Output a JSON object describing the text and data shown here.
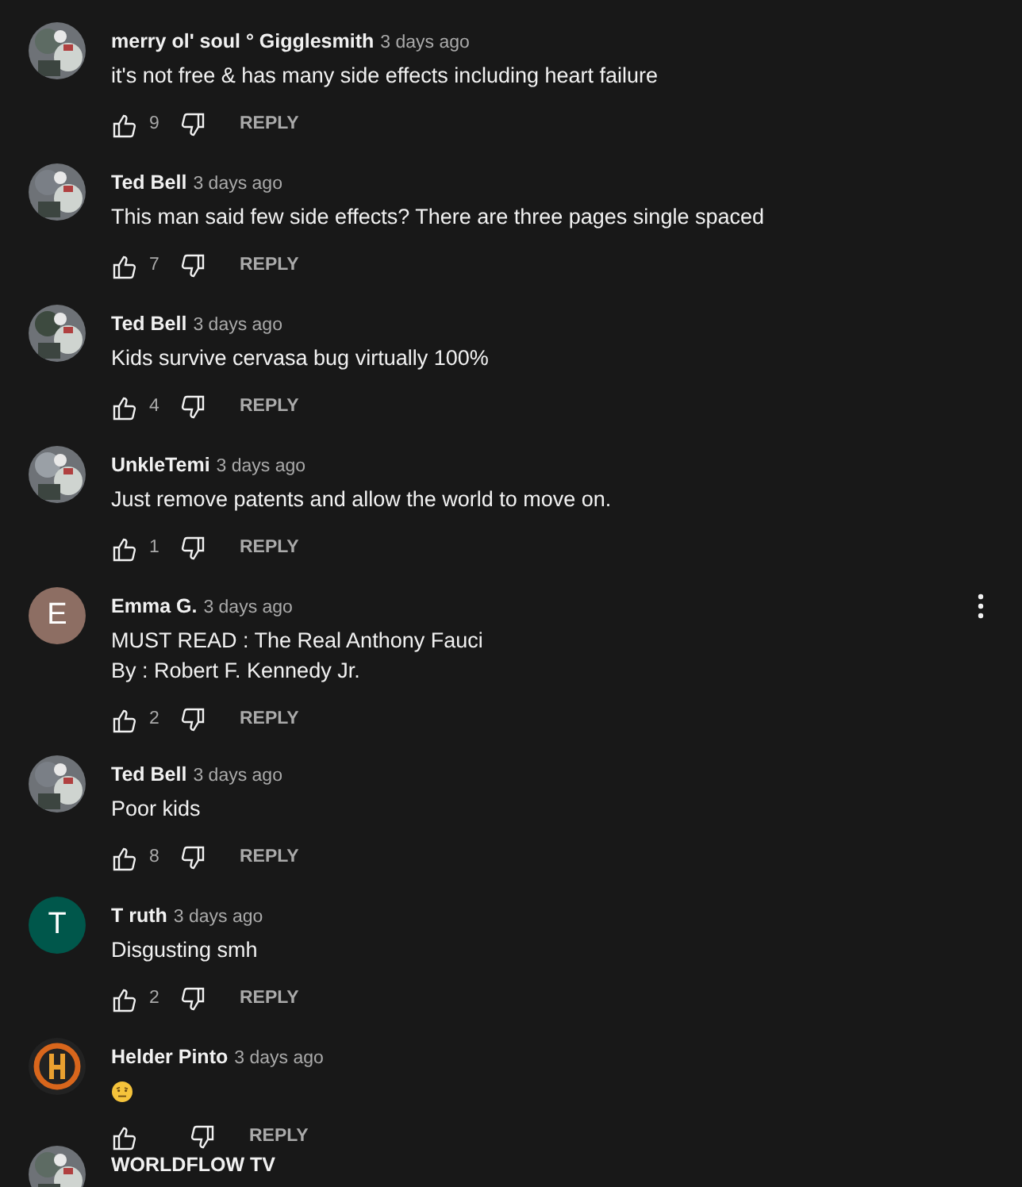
{
  "comments": [
    {
      "author": "merry ol' soul ° Gigglesmith",
      "time": "3 days ago",
      "avatar": {
        "kind": "picture"
      },
      "lines": [
        "it's not free & has many side effects including heart failure"
      ],
      "likes": "9",
      "reply": "REPLY",
      "menu": false
    },
    {
      "author": "Ted Bell",
      "time": "3 days ago",
      "avatar": {
        "kind": "picture"
      },
      "lines": [
        "This man said few side effects? There are three pages single spaced"
      ],
      "likes": "7",
      "reply": "REPLY",
      "menu": false
    },
    {
      "author": "Ted Bell",
      "time": "3 days ago",
      "avatar": {
        "kind": "picture"
      },
      "lines": [
        "Kids survive cervasa bug virtually 100%"
      ],
      "likes": "4",
      "reply": "REPLY",
      "menu": false
    },
    {
      "author": "UnkleTemi",
      "time": "3 days ago",
      "avatar": {
        "kind": "picture"
      },
      "lines": [
        "Just remove patents and allow the world to move on."
      ],
      "likes": "1",
      "reply": "REPLY",
      "menu": false
    },
    {
      "author": "Emma G.",
      "time": "3 days ago",
      "avatar": {
        "kind": "letter",
        "letter": "E",
        "color": "#8d6e63"
      },
      "lines": [
        "MUST READ : The Real Anthony Fauci",
        "By : Robert F. Kennedy Jr."
      ],
      "likes": "2",
      "reply": "REPLY",
      "menu": true
    },
    {
      "author": "Ted Bell",
      "time": "3 days ago",
      "avatar": {
        "kind": "picture"
      },
      "lines": [
        "Poor kids"
      ],
      "likes": "8",
      "reply": "REPLY",
      "menu": false
    },
    {
      "author": "T ruth",
      "time": "3 days ago",
      "avatar": {
        "kind": "letter",
        "letter": "T",
        "color": "#00574b"
      },
      "lines": [
        "Disgusting smh"
      ],
      "likes": "2",
      "reply": "REPLY",
      "menu": false
    },
    {
      "author": "Helder Pinto",
      "time": "3 days ago",
      "avatar": {
        "kind": "picture"
      },
      "kind": "emoji",
      "reply": "REPLY",
      "menu": false
    },
    {
      "author": "WORLDFLOW TV",
      "avatar": {
        "kind": "picture"
      }
    }
  ]
}
